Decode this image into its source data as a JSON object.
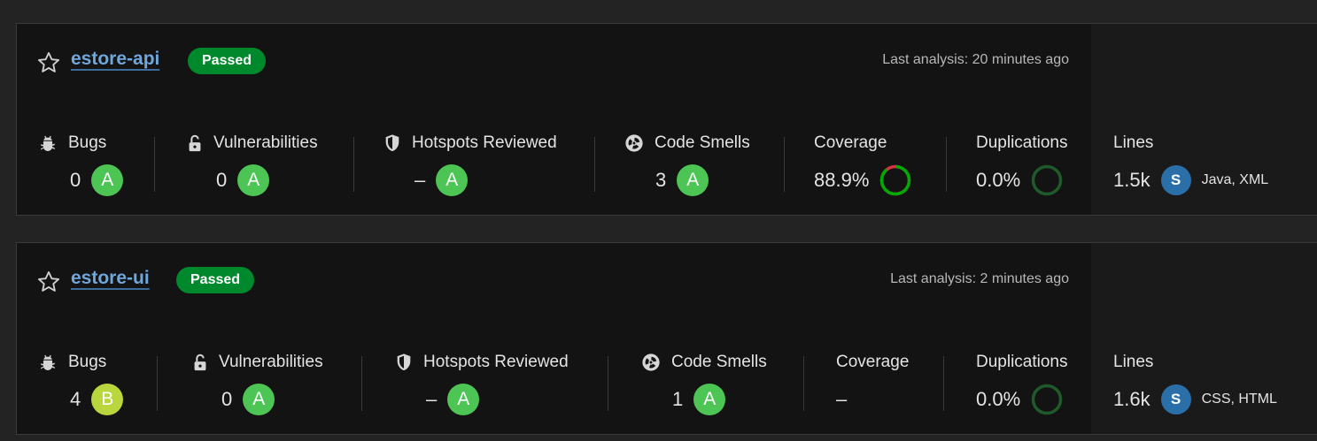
{
  "projects": [
    {
      "name": "estore-api",
      "status": "Passed",
      "last_analysis": "Last analysis: 20 minutes ago",
      "metrics": {
        "bugs": {
          "label": "Bugs",
          "value": "0",
          "rating": "A"
        },
        "vulnerabilities": {
          "label": "Vulnerabilities",
          "value": "0",
          "rating": "A"
        },
        "hotspots": {
          "label": "Hotspots Reviewed",
          "value": "–",
          "rating": "A"
        },
        "code_smells": {
          "label": "Code Smells",
          "value": "3",
          "rating": "A"
        },
        "coverage": {
          "label": "Coverage",
          "value": "88.9%",
          "percent": 88.9
        },
        "duplications": {
          "label": "Duplications",
          "value": "0.0%",
          "percent": 0.0
        },
        "lines": {
          "label": "Lines",
          "value": "1.5k",
          "avatar": "S",
          "languages": "Java, XML"
        }
      }
    },
    {
      "name": "estore-ui",
      "status": "Passed",
      "last_analysis": "Last analysis: 2 minutes ago",
      "metrics": {
        "bugs": {
          "label": "Bugs",
          "value": "4",
          "rating": "B"
        },
        "vulnerabilities": {
          "label": "Vulnerabilities",
          "value": "0",
          "rating": "A"
        },
        "hotspots": {
          "label": "Hotspots Reviewed",
          "value": "–",
          "rating": "A"
        },
        "code_smells": {
          "label": "Code Smells",
          "value": "1",
          "rating": "A"
        },
        "coverage": {
          "label": "Coverage",
          "value": "–"
        },
        "duplications": {
          "label": "Duplications",
          "value": "0.0%",
          "percent": 0.0
        },
        "lines": {
          "label": "Lines",
          "value": "1.6k",
          "avatar": "S",
          "languages": "CSS, HTML"
        }
      }
    }
  ],
  "icons": {
    "favorite": "star-outline-icon",
    "bugs": "bug-icon",
    "vulnerabilities": "unlocked-padlock-icon",
    "hotspots": "shield-icon",
    "code_smells": "radiation-icon"
  },
  "colors": {
    "rating_A": "#4dc554",
    "rating_B": "#b9d63c",
    "passed": "#00882c",
    "coverage_good": "#00aa00",
    "coverage_uncovered": "#d4333f",
    "duplications_ring": "#1e5a2a",
    "avatar": "#2b6fa9",
    "link": "#6fa6dc"
  }
}
